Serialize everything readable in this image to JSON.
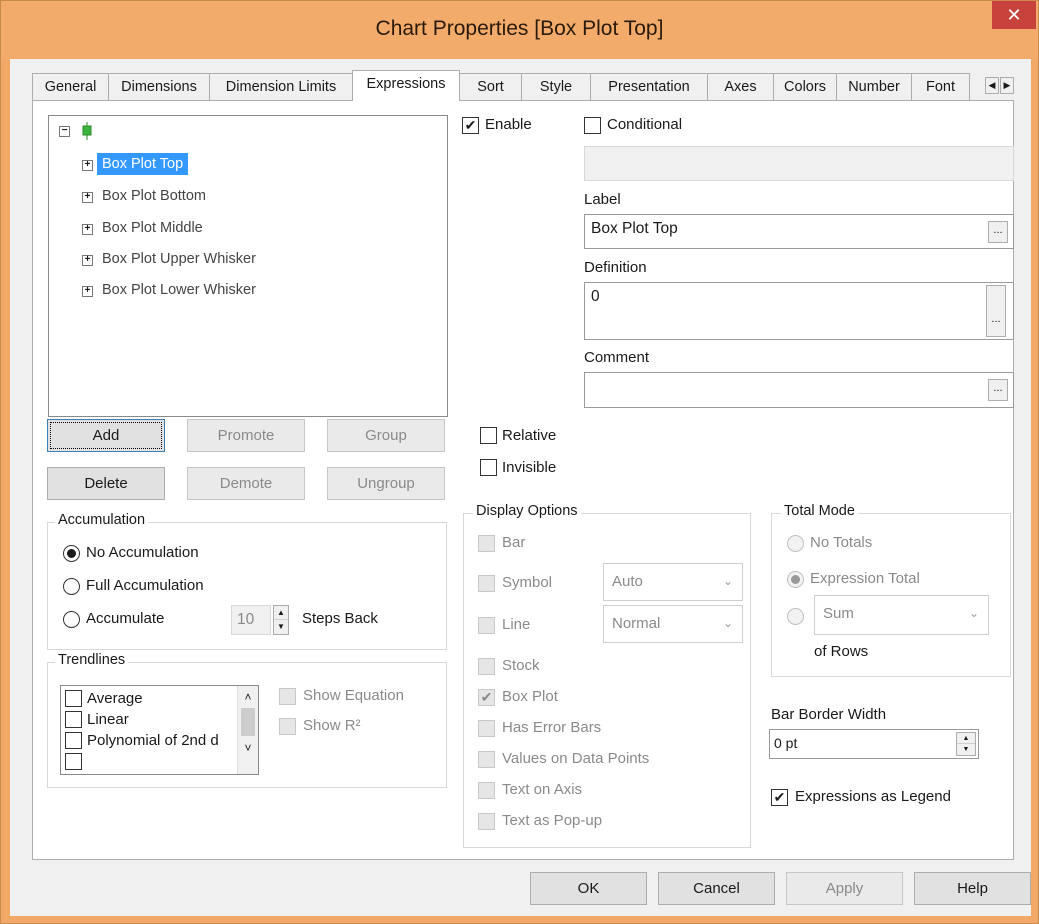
{
  "window": {
    "title": "Chart Properties [Box Plot Top]"
  },
  "tabs": [
    "General",
    "Dimensions",
    "Dimension Limits",
    "Expressions",
    "Sort",
    "Style",
    "Presentation",
    "Axes",
    "Colors",
    "Number",
    "Font"
  ],
  "tree": {
    "items": [
      "Box Plot Top",
      "Box Plot Bottom",
      "Box Plot Middle",
      "Box Plot Upper Whisker",
      "Box Plot Lower Whisker"
    ]
  },
  "expr_buttons": {
    "add": "Add",
    "promote": "Promote",
    "group": "Group",
    "delete": "Delete",
    "demote": "Demote",
    "ungroup": "Ungroup"
  },
  "accumulation": {
    "title": "Accumulation",
    "no_acc": "No Accumulation",
    "full_acc": "Full Accumulation",
    "acc": "Accumulate",
    "steps_value": "10",
    "steps_label": "Steps Back"
  },
  "trendlines": {
    "title": "Trendlines",
    "items": [
      "Average",
      "Linear",
      "Polynomial of 2nd d"
    ],
    "show_equation": "Show Equation",
    "show_r2": "Show R²"
  },
  "right": {
    "enable": "Enable",
    "conditional": "Conditional",
    "label_caption": "Label",
    "label_value": "Box Plot Top",
    "definition_caption": "Definition",
    "definition_value": "0",
    "comment_caption": "Comment",
    "comment_value": "",
    "relative": "Relative",
    "invisible": "Invisible",
    "ellipsis": "..."
  },
  "display_options": {
    "title": "Display Options",
    "bar": "Bar",
    "symbol": "Symbol",
    "symbol_select": "Auto",
    "line": "Line",
    "line_select": "Normal",
    "stock": "Stock",
    "box_plot": "Box Plot",
    "error_bars": "Has Error Bars",
    "values": "Values on Data Points",
    "text_axis": "Text on Axis",
    "popup": "Text as Pop-up"
  },
  "total_mode": {
    "title": "Total Mode",
    "no_totals": "No Totals",
    "expr_total": "Expression Total",
    "sum": "Sum",
    "of_rows": "of Rows"
  },
  "bar_border": {
    "caption": "Bar Border Width",
    "value": "0 pt"
  },
  "expressions_legend": "Expressions as Legend",
  "footer": {
    "ok": "OK",
    "cancel": "Cancel",
    "apply": "Apply",
    "help": "Help"
  }
}
